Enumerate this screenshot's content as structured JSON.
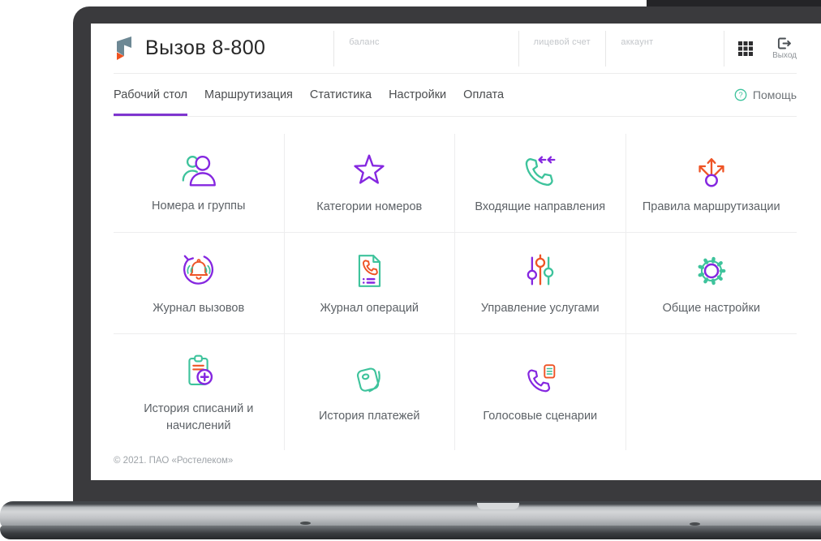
{
  "header": {
    "app_title": "Вызов 8-800",
    "balance_label": "баланс",
    "personal_account_label": "лицевой счет",
    "account_label": "аккаунт",
    "logout_label": "Выход"
  },
  "nav": {
    "tabs": [
      {
        "label": "Рабочий стол",
        "active": true
      },
      {
        "label": "Маршрутизация",
        "active": false
      },
      {
        "label": "Статистика",
        "active": false
      },
      {
        "label": "Настройки",
        "active": false
      },
      {
        "label": "Оплата",
        "active": false
      }
    ],
    "help_label": "Помощь"
  },
  "tiles": [
    {
      "label": "Номера и группы",
      "icon": "users-icon"
    },
    {
      "label": "Категории номеров",
      "icon": "star-icon"
    },
    {
      "label": "Входящие направления",
      "icon": "phone-incoming-icon"
    },
    {
      "label": "Правила маршрутизации",
      "icon": "routing-arrows-icon"
    },
    {
      "label": "Журнал вызовов",
      "icon": "bell-circular-arrow-icon"
    },
    {
      "label": "Журнал операций",
      "icon": "document-phone-icon"
    },
    {
      "label": "Управление услугами",
      "icon": "sliders-icon"
    },
    {
      "label": "Общие настройки",
      "icon": "gear-icon"
    },
    {
      "label": "История списаний и начислений",
      "icon": "clipboard-plus-icon"
    },
    {
      "label": "История платежей",
      "icon": "wallet-icon"
    },
    {
      "label": "Голосовые сценарии",
      "icon": "phone-script-icon"
    }
  ],
  "footer": {
    "copyright": "© 2021. ПАО «Ростелеком»"
  },
  "colors": {
    "purple": "#8527e0",
    "teal": "#3ec39c",
    "orange": "#ee5426",
    "active_tab_underline": "#7e35cf",
    "logo_slate": "#6d8894",
    "logo_orange": "#f0521f"
  }
}
